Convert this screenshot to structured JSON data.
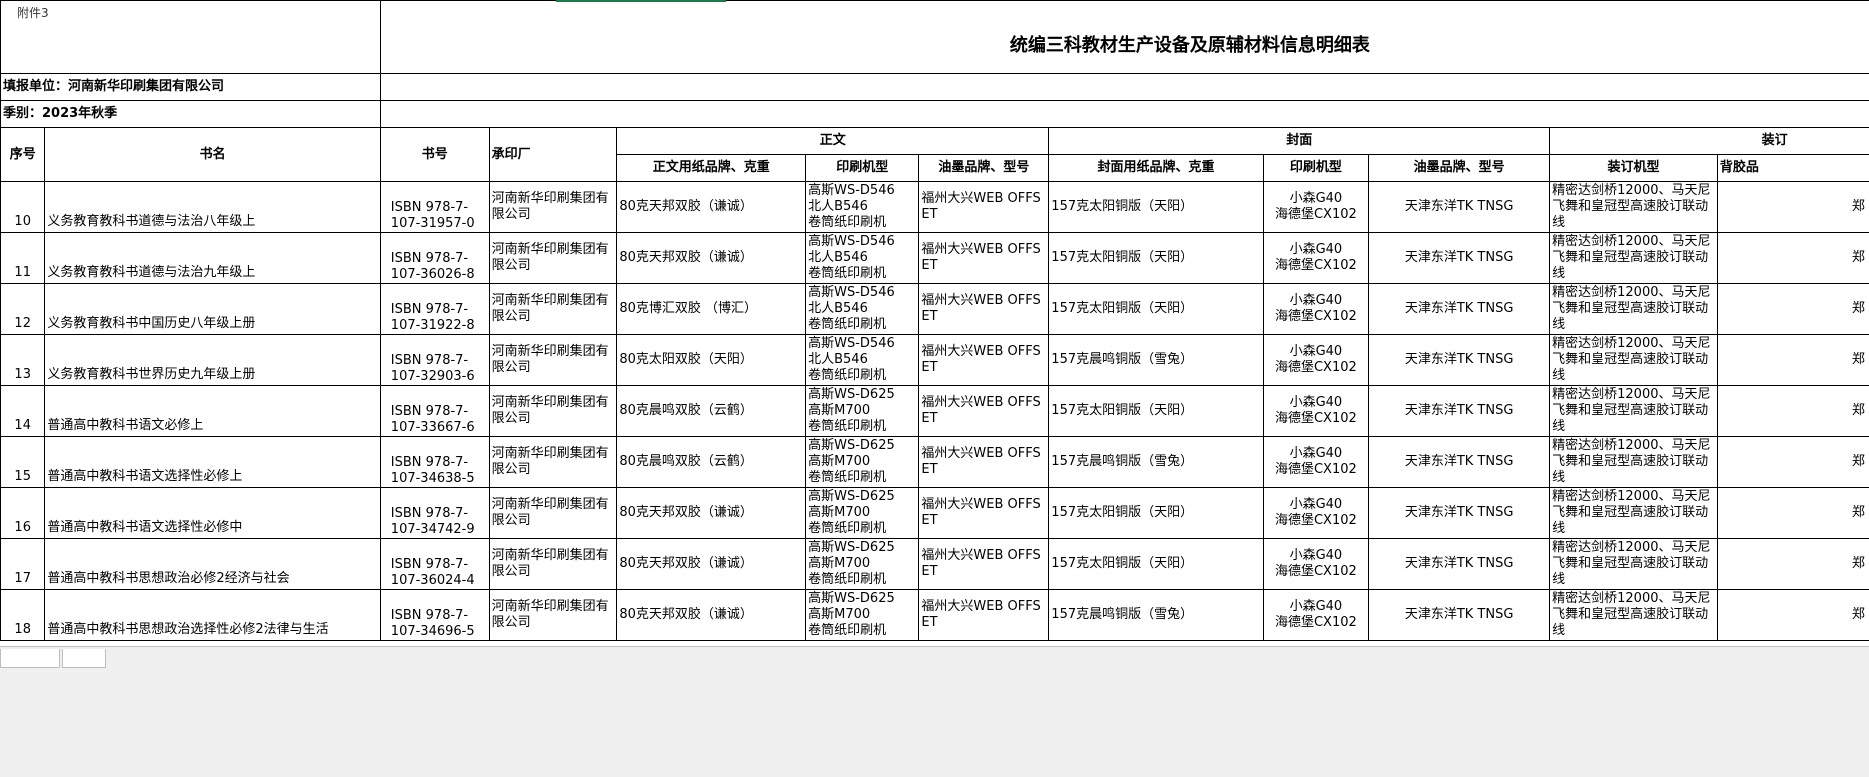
{
  "attachment_label": "附件3",
  "title": "统编三科教材生产设备及原辅材料信息明细表",
  "reporter": "填报单位：河南新华印刷集团有限公司",
  "season": "季别：2023年秋季",
  "headers": {
    "index": "序号",
    "book_name": "书名",
    "isbn": "书号",
    "printer": "承印厂",
    "text_group": "正文",
    "cover_group": "封面",
    "binding_group": "装订",
    "text_paper": "正文用纸品牌、克重",
    "text_press": "印刷机型",
    "text_ink": "油墨品牌、型号",
    "cover_paper": "封面用纸品牌、克重",
    "cover_press": "印刷机型",
    "cover_ink": "油墨品牌、型号",
    "binding_machine": "装订机型",
    "spine_partial": "背胶品"
  },
  "rows": [
    {
      "idx": "10",
      "name": "义务教育教科书道德与法治八年级上",
      "isbn": "ISBN 978-7-107-31957-0",
      "printer": "河南新华印刷集团有限公司",
      "tpaper": "80克天邦双胶（谦诚）",
      "tp1": "高斯WS-D546",
      "tp2": "北人B546",
      "tp3": "卷筒纸印刷机",
      "tink": "福州大兴WEB OFFSET",
      "cpaper": "157克太阳铜版（天阳）",
      "cp1": "小森G40",
      "cp2": "海德堡CX102",
      "cink": "天津东洋TK TNSG",
      "bind": "精密达剑桥12000、马天尼飞舞和皇冠型高速胶订联动线",
      "spine": "郑"
    },
    {
      "idx": "11",
      "name": "义务教育教科书道德与法治九年级上",
      "isbn": "ISBN 978-7-107-36026-8",
      "printer": "河南新华印刷集团有限公司",
      "tpaper": "80克天邦双胶（谦诚）",
      "tp1": "高斯WS-D546",
      "tp2": "北人B546",
      "tp3": "卷筒纸印刷机",
      "tink": "福州大兴WEB OFFSET",
      "cpaper": "157克太阳铜版（天阳）",
      "cp1": "小森G40",
      "cp2": "海德堡CX102",
      "cink": "天津东洋TK TNSG",
      "bind": "精密达剑桥12000、马天尼飞舞和皇冠型高速胶订联动线",
      "spine": "郑"
    },
    {
      "idx": "12",
      "name": "义务教育教科书中国历史八年级上册",
      "isbn": "ISBN 978-7-107-31922-8",
      "printer": "河南新华印刷集团有限公司",
      "tpaper": "80克博汇双胶 （博汇）",
      "tp1": "高斯WS-D546",
      "tp2": "北人B546",
      "tp3": "卷筒纸印刷机",
      "tink": "福州大兴WEB OFFSET",
      "cpaper": "157克太阳铜版（天阳）",
      "cp1": "小森G40",
      "cp2": "海德堡CX102",
      "cink": "天津东洋TK TNSG",
      "bind": "精密达剑桥12000、马天尼飞舞和皇冠型高速胶订联动线",
      "spine": "郑"
    },
    {
      "idx": "13",
      "name": "义务教育教科书世界历史九年级上册",
      "isbn": "ISBN 978-7-107-32903-6",
      "printer": "河南新华印刷集团有限公司",
      "tpaper": "80克太阳双胶（天阳）",
      "tp1": "高斯WS-D546",
      "tp2": "北人B546",
      "tp3": "卷筒纸印刷机",
      "tink": "福州大兴WEB OFFSET",
      "cpaper": "157克晨鸣铜版（雪兔）",
      "cp1": "小森G40",
      "cp2": "海德堡CX102",
      "cink": "天津东洋TK TNSG",
      "bind": "精密达剑桥12000、马天尼飞舞和皇冠型高速胶订联动线",
      "spine": "郑"
    },
    {
      "idx": "14",
      "name": "普通高中教科书语文必修上",
      "isbn": "ISBN 978-7-107-33667-6",
      "printer": "河南新华印刷集团有限公司",
      "tpaper": "80克晨鸣双胶（云鹤）",
      "tp1": "高斯WS-D625",
      "tp2": "高斯M700",
      "tp3": "卷筒纸印刷机",
      "tink": "福州大兴WEB OFFSET",
      "cpaper": "157克太阳铜版（天阳）",
      "cp1": "小森G40",
      "cp2": "海德堡CX102",
      "cink": "天津东洋TK TNSG",
      "bind": "精密达剑桥12000、马天尼飞舞和皇冠型高速胶订联动线",
      "spine": "郑"
    },
    {
      "idx": "15",
      "name": "普通高中教科书语文选择性必修上",
      "isbn": "ISBN 978-7-107-34638-5",
      "printer": "河南新华印刷集团有限公司",
      "tpaper": "80克晨鸣双胶（云鹤）",
      "tp1": "高斯WS-D625",
      "tp2": "高斯M700",
      "tp3": "卷筒纸印刷机",
      "tink": "福州大兴WEB OFFSET",
      "cpaper": "157克晨鸣铜版（雪兔）",
      "cp1": "小森G40",
      "cp2": "海德堡CX102",
      "cink": "天津东洋TK TNSG",
      "bind": "精密达剑桥12000、马天尼飞舞和皇冠型高速胶订联动线",
      "spine": "郑"
    },
    {
      "idx": "16",
      "name": "普通高中教科书语文选择性必修中",
      "isbn": "ISBN 978-7-107-34742-9",
      "printer": "河南新华印刷集团有限公司",
      "tpaper": "80克天邦双胶（谦诚）",
      "tp1": "高斯WS-D625",
      "tp2": "高斯M700",
      "tp3": "卷筒纸印刷机",
      "tink": "福州大兴WEB OFFSET",
      "cpaper": "157克太阳铜版（天阳）",
      "cp1": "小森G40",
      "cp2": "海德堡CX102",
      "cink": "天津东洋TK TNSG",
      "bind": "精密达剑桥12000、马天尼飞舞和皇冠型高速胶订联动线",
      "spine": "郑"
    },
    {
      "idx": "17",
      "name": "普通高中教科书思想政治必修2经济与社会",
      "isbn": "ISBN 978-7-107-36024-4",
      "printer": "河南新华印刷集团有限公司",
      "tpaper": "80克天邦双胶（谦诚）",
      "tp1": "高斯WS-D625",
      "tp2": "高斯M700",
      "tp3": "卷筒纸印刷机",
      "tink": "福州大兴WEB OFFSET",
      "cpaper": "157克太阳铜版（天阳）",
      "cp1": "小森G40",
      "cp2": "海德堡CX102",
      "cink": "天津东洋TK TNSG",
      "bind": "精密达剑桥12000、马天尼飞舞和皇冠型高速胶订联动线",
      "spine": "郑"
    },
    {
      "idx": "18",
      "name": "普通高中教科书思想政治选择性必修2法律与生活",
      "isbn": "ISBN 978-7-107-34696-5",
      "printer": "河南新华印刷集团有限公司",
      "tpaper": "80克天邦双胶（谦诚）",
      "tp1": "高斯WS-D625",
      "tp2": "高斯M700",
      "tp3": "卷筒纸印刷机",
      "tink": "福州大兴WEB OFFSET",
      "cpaper": "157克晨鸣铜版（雪兔）",
      "cp1": "小森G40",
      "cp2": "海德堡CX102",
      "cink": "天津东洋TK TNSG",
      "bind": "精密达剑桥12000、马天尼飞舞和皇冠型高速胶订联动线",
      "spine": "郑"
    }
  ]
}
